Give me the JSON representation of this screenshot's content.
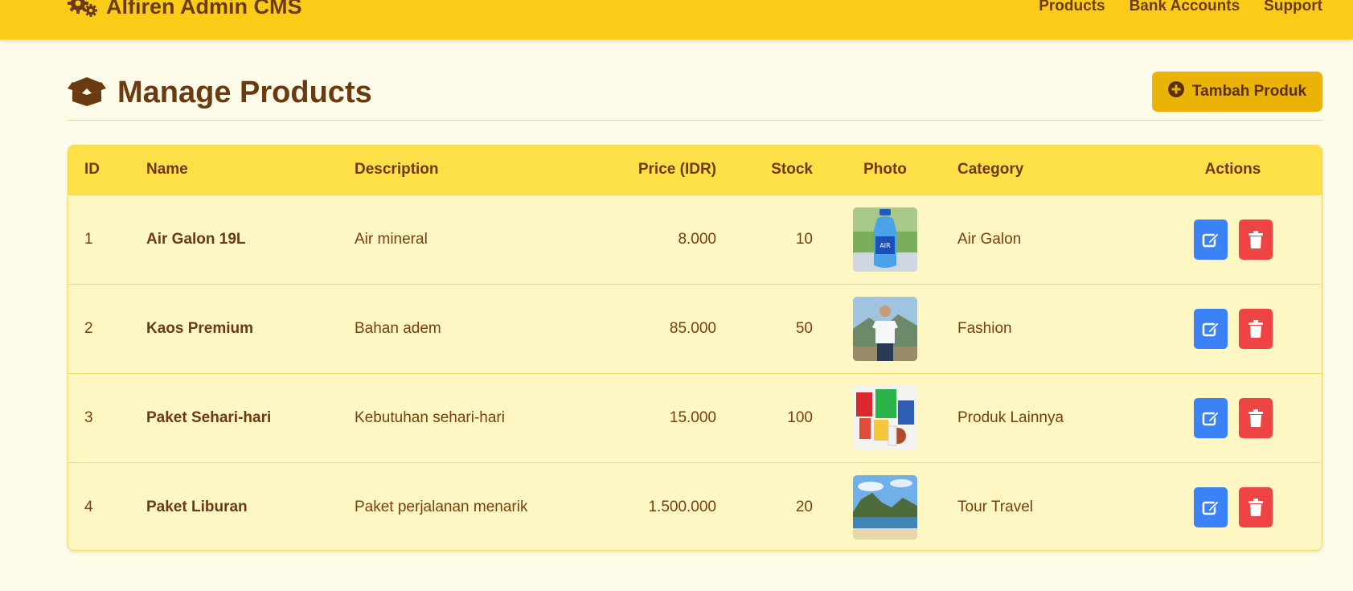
{
  "navbar": {
    "brand": "Alfiren Admin CMS",
    "links": [
      "Products",
      "Bank Accounts",
      "Support"
    ],
    "color": "#fbcc17"
  },
  "header": {
    "title": "Manage Products",
    "add_button": "Tambah Produk"
  },
  "table": {
    "columns": [
      "ID",
      "Name",
      "Description",
      "Price (IDR)",
      "Stock",
      "Photo",
      "Category",
      "Actions"
    ],
    "rows": [
      {
        "id": "1",
        "name": "Air Galon 19L",
        "description": "Air mineral",
        "price": "8.000",
        "stock": "10",
        "photo": "water-gallon-photo",
        "category": "Air Galon"
      },
      {
        "id": "2",
        "name": "Kaos Premium",
        "description": "Bahan adem",
        "price": "85.000",
        "stock": "50",
        "photo": "tshirt-model-photo",
        "category": "Fashion"
      },
      {
        "id": "3",
        "name": "Paket Sehari-hari",
        "description": "Kebutuhan sehari-hari",
        "price": "15.000",
        "stock": "100",
        "photo": "groceries-photo",
        "category": "Produk Lainnya"
      },
      {
        "id": "4",
        "name": "Paket Liburan",
        "description": "Paket perjalanan menarik",
        "price": "1.500.000",
        "stock": "20",
        "photo": "beach-island-photo",
        "category": "Tour Travel"
      }
    ]
  },
  "colors": {
    "edit": "#3b82f6",
    "delete": "#ef4444",
    "accent": "#eab308",
    "text": "#6b3a10"
  }
}
